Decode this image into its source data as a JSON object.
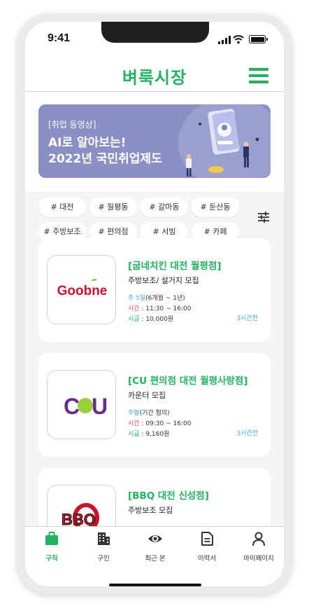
{
  "status": {
    "time": "9:41"
  },
  "header": {
    "title": "벼룩시장"
  },
  "banner": {
    "tag": "[취업 동영상]",
    "line1": "AI로 알아보는!",
    "line2": "2022년 국민취업제도"
  },
  "chips": [
    "# 대전",
    "# 월평동",
    "# 갈마동",
    "# 둔산동",
    "# 주방보조",
    "# 편의점",
    "# 서빙",
    "# 카페"
  ],
  "jobs": [
    {
      "logo": "Goobne",
      "name": "[굽네치킨 대전 월평점]",
      "role": "주방보조/ 설거지 모집",
      "day_label": "주 5일",
      "day_note": "(6개월 ~ 1년)",
      "time_label": "시간",
      "time": " : 11:30 ~ 16:00",
      "pay_label": "시급",
      "pay": " : 10,000원",
      "ago": "3시간전"
    },
    {
      "logo": "CU",
      "name": "[CU 편의점 대전 월평사랑점]",
      "role": "카운터 모집",
      "day_label": "주말",
      "day_note": "(기간 협의)",
      "time_label": "시간",
      "time": " : 09:30 ~ 16:00",
      "pay_label": "시급",
      "pay": " : 9,160원",
      "ago": "3시간전"
    },
    {
      "logo": "BBQ",
      "name": "[BBQ 대전 신성점]",
      "role": "주방보조 모집"
    }
  ],
  "tabs": [
    {
      "label": "구직",
      "icon": "briefcase-icon",
      "active": true
    },
    {
      "label": "구인",
      "icon": "building-icon"
    },
    {
      "label": "최근 본",
      "icon": "eye-icon"
    },
    {
      "label": "이력서",
      "icon": "document-icon"
    },
    {
      "label": "마이페이지",
      "icon": "person-icon"
    }
  ],
  "colors": {
    "accent": "#21b45f",
    "banner": "#8a8fc4",
    "blue": "#3fa3e0",
    "red": "#ef4d4d"
  }
}
